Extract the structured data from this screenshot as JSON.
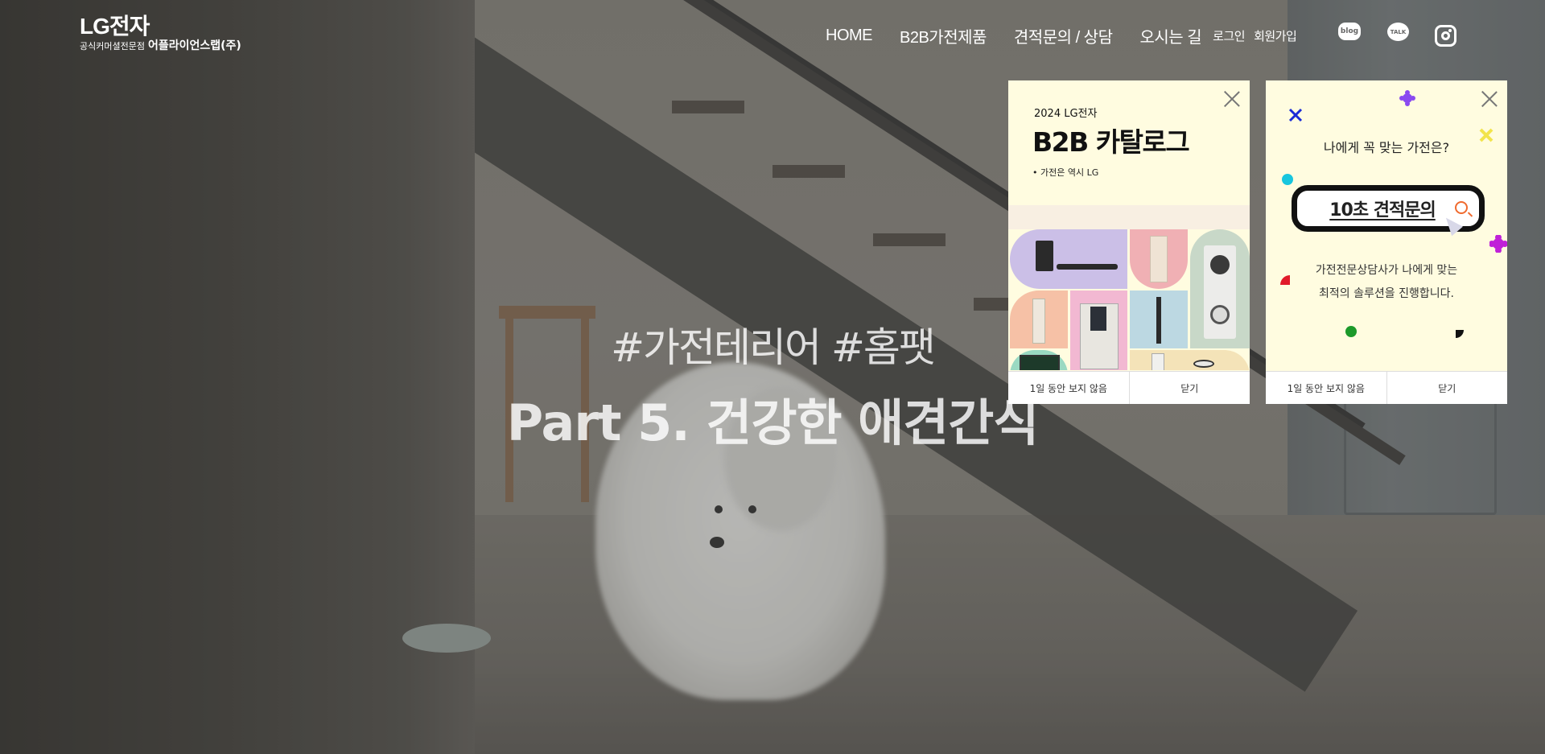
{
  "brand": {
    "logo": "LG전자",
    "subtitle": "공식커머셜전문점",
    "store_name": "어플라이언스랩(주)"
  },
  "nav": {
    "items": [
      "HOME",
      "B2B가전제품",
      "견적문의 / 상담",
      "오시는 길"
    ],
    "login": "로그인",
    "signup": "회원가입",
    "social": {
      "blog": {
        "icon": "blog-icon",
        "label": "blog"
      },
      "talk": {
        "icon": "kakaotalk-icon",
        "label": "TALK"
      },
      "instagram": {
        "icon": "instagram-icon"
      }
    }
  },
  "hero": {
    "tags": "#가전테리어 #홈팻",
    "title": "Part 5. 건강한 애견간식"
  },
  "popups": {
    "catalog": {
      "year_brand": "2024 LG전자",
      "title": "B2B 카탈로그",
      "slogan": "• 가전은 역시 LG",
      "dismiss_day": "1일 동안 보지 않음",
      "close": "닫기"
    },
    "quote": {
      "question": "나에게 꼭 맞는 가전은?",
      "search_label": "10초 견적문의",
      "description_line1": "가전전문상담사가 나에게 맞는",
      "description_line2": "최적의 솔루션을 진행합니다.",
      "dismiss_day": "1일 동안 보지 않음",
      "close": "닫기"
    }
  },
  "colors": {
    "popup_bg": "#fffce0",
    "search_icon": "#f06a2e",
    "text_white": "#ffffff"
  }
}
